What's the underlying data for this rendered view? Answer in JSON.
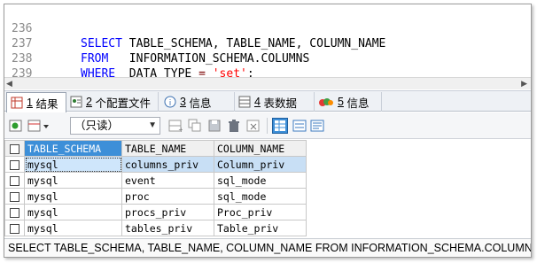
{
  "editor": {
    "lines": [
      {
        "num": "236",
        "kw": "SELECT",
        "rest": "TABLE_SCHEMA, TABLE_NAME, COLUMN_NAME"
      },
      {
        "num": "237",
        "kw": "FROM",
        "rest": "INFORMATION_SCHEMA.COLUMNS"
      },
      {
        "num": "238",
        "kw": "WHERE",
        "rest": "DATA_TYPE",
        "op": "=",
        "str": "'set'",
        "end": ";"
      },
      {
        "num": "239"
      },
      {
        "num": "240"
      }
    ]
  },
  "tabs": [
    {
      "num": "1",
      "label": "结果",
      "icon": "grid-icon"
    },
    {
      "num": "2",
      "label": "个配置文件",
      "icon": "profile-icon"
    },
    {
      "num": "3",
      "label": "信息",
      "icon": "info-icon"
    },
    {
      "num": "4",
      "label": "表数据",
      "icon": "table-data-icon"
    },
    {
      "num": "5",
      "label": "信息",
      "icon": "history-icon"
    }
  ],
  "toolbar": {
    "mode_value": "（只读）"
  },
  "grid": {
    "columns": [
      "TABLE_SCHEMA",
      "TABLE_NAME",
      "COLUMN_NAME"
    ],
    "rows": [
      [
        "mysql",
        "columns_priv",
        "Column_priv"
      ],
      [
        "mysql",
        "event",
        "sql_mode"
      ],
      [
        "mysql",
        "proc",
        "sql_mode"
      ],
      [
        "mysql",
        "procs_priv",
        "Proc_priv"
      ],
      [
        "mysql",
        "tables_priv",
        "Table_priv"
      ]
    ]
  },
  "status": {
    "text": "SELECT TABLE_SCHEMA, TABLE_NAME, COLUMN_NAME FROM INFORMATION_SCHEMA.COLUMNS WHERE DATA_TYPE = 'set'"
  },
  "colors": {
    "keyword": "#0000ff",
    "string": "#ff0000",
    "selected_header": "#3d8fd8",
    "selected_row": "#c8dff5"
  }
}
